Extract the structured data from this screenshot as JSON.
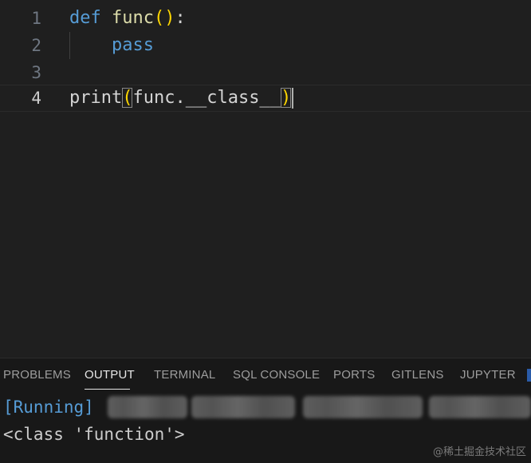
{
  "editor": {
    "lines": [
      {
        "number": "1",
        "tokens": {
          "kw": "def",
          "space": " ",
          "name": "func",
          "open": "(",
          "close": ")",
          "colon": ":"
        }
      },
      {
        "number": "2",
        "tokens": {
          "indent": "    ",
          "kw": "pass"
        }
      },
      {
        "number": "3"
      },
      {
        "number": "4",
        "tokens": {
          "fn": "print",
          "open": "(",
          "obj": "func",
          "dot": ".",
          "attr": "__class__",
          "close": ")"
        }
      }
    ],
    "active_line": "4"
  },
  "panel": {
    "tabs": [
      {
        "label": "PROBLEMS"
      },
      {
        "label": "OUTPUT"
      },
      {
        "label": "TERMINAL"
      },
      {
        "label": "SQL CONSOLE"
      },
      {
        "label": "PORTS"
      },
      {
        "label": "GITLENS"
      },
      {
        "label": "JUPYTER"
      }
    ],
    "active_tab": "OUTPUT",
    "output": {
      "running_label": "[Running]",
      "result_line": "<class 'function'>"
    }
  },
  "watermark": "@稀土掘金技术社区",
  "colors": {
    "background": "#1f1f1f",
    "panel_background": "#181818",
    "keyword": "#569cd6",
    "function": "#dcdcaa",
    "bracket": "#ffd700"
  }
}
